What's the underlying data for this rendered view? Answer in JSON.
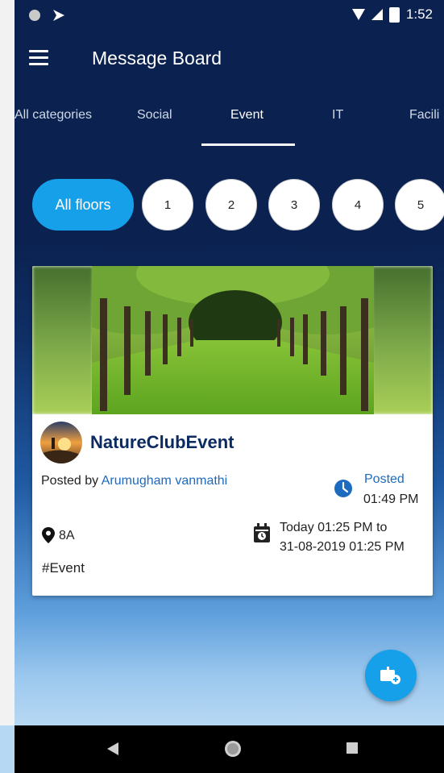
{
  "status_bar": {
    "time": "1:52"
  },
  "app_bar": {
    "title": "Message Board"
  },
  "tabs": [
    {
      "label": "All categories"
    },
    {
      "label": "Social"
    },
    {
      "label": "Event"
    },
    {
      "label": "IT"
    },
    {
      "label": "Facili"
    }
  ],
  "floors": [
    {
      "label": "All floors"
    },
    {
      "label": "1"
    },
    {
      "label": "2"
    },
    {
      "label": "3"
    },
    {
      "label": "4"
    },
    {
      "label": "5"
    }
  ],
  "card": {
    "title": "NatureClubEvent",
    "posted_by_prefix": "Posted by",
    "posted_by_name": "Arumugham vanmathi",
    "posted_label": "Posted",
    "posted_time": "01:49 PM",
    "location": "8A",
    "date_line1": "Today 01:25 PM  to",
    "date_line2": "31-08-2019 01:25 PM",
    "hashtag": "#Event"
  },
  "colors": {
    "header_bg": "#0b2250",
    "accent": "#16a0ea",
    "link": "#1c6bbf",
    "title_dark": "#0b2a62"
  },
  "icons": {
    "menu": "menu-icon",
    "clock": "clock-icon",
    "pin": "map-pin-icon",
    "calendar": "calendar-clock-icon",
    "fab": "add-message-icon",
    "nav_back": "back-triangle-icon",
    "nav_home": "home-circle-icon",
    "nav_recents": "recents-square-icon"
  }
}
